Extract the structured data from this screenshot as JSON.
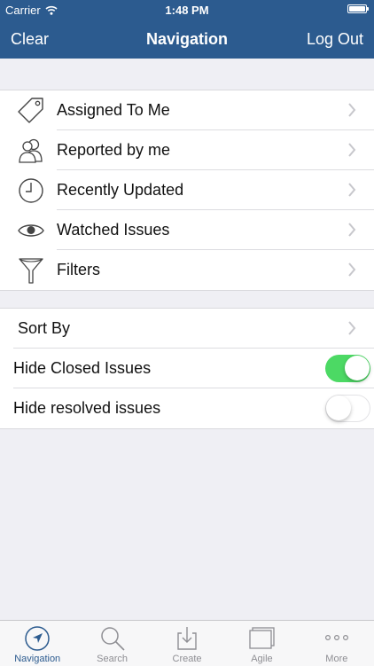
{
  "status_bar": {
    "carrier": "Carrier",
    "time": "1:48 PM"
  },
  "nav_bar": {
    "left_button": "Clear",
    "title": "Navigation",
    "right_button": "Log Out"
  },
  "navigation_items": [
    {
      "label": "Assigned To Me",
      "icon": "tag-icon"
    },
    {
      "label": "Reported by me",
      "icon": "users-icon"
    },
    {
      "label": "Recently Updated",
      "icon": "clock-icon"
    },
    {
      "label": "Watched Issues",
      "icon": "eye-icon"
    },
    {
      "label": "Filters",
      "icon": "funnel-icon"
    }
  ],
  "settings": {
    "sort_by": {
      "label": "Sort By"
    },
    "hide_closed": {
      "label": "Hide Closed Issues",
      "on": true
    },
    "hide_resolved": {
      "label": "Hide resolved issues",
      "on": false
    }
  },
  "colors": {
    "nav_bar": "#2c5b8f",
    "toggle_on": "#4cd964",
    "tab_active": "#2c5b8f",
    "tab_inactive": "#8e8e93"
  },
  "tab_bar": [
    {
      "label": "Navigation",
      "icon": "location-arrow-icon",
      "active": true
    },
    {
      "label": "Search",
      "icon": "search-icon",
      "active": false
    },
    {
      "label": "Create",
      "icon": "create-icon",
      "active": false
    },
    {
      "label": "Agile",
      "icon": "agile-icon",
      "active": false
    },
    {
      "label": "More",
      "icon": "more-icon",
      "active": false
    }
  ]
}
